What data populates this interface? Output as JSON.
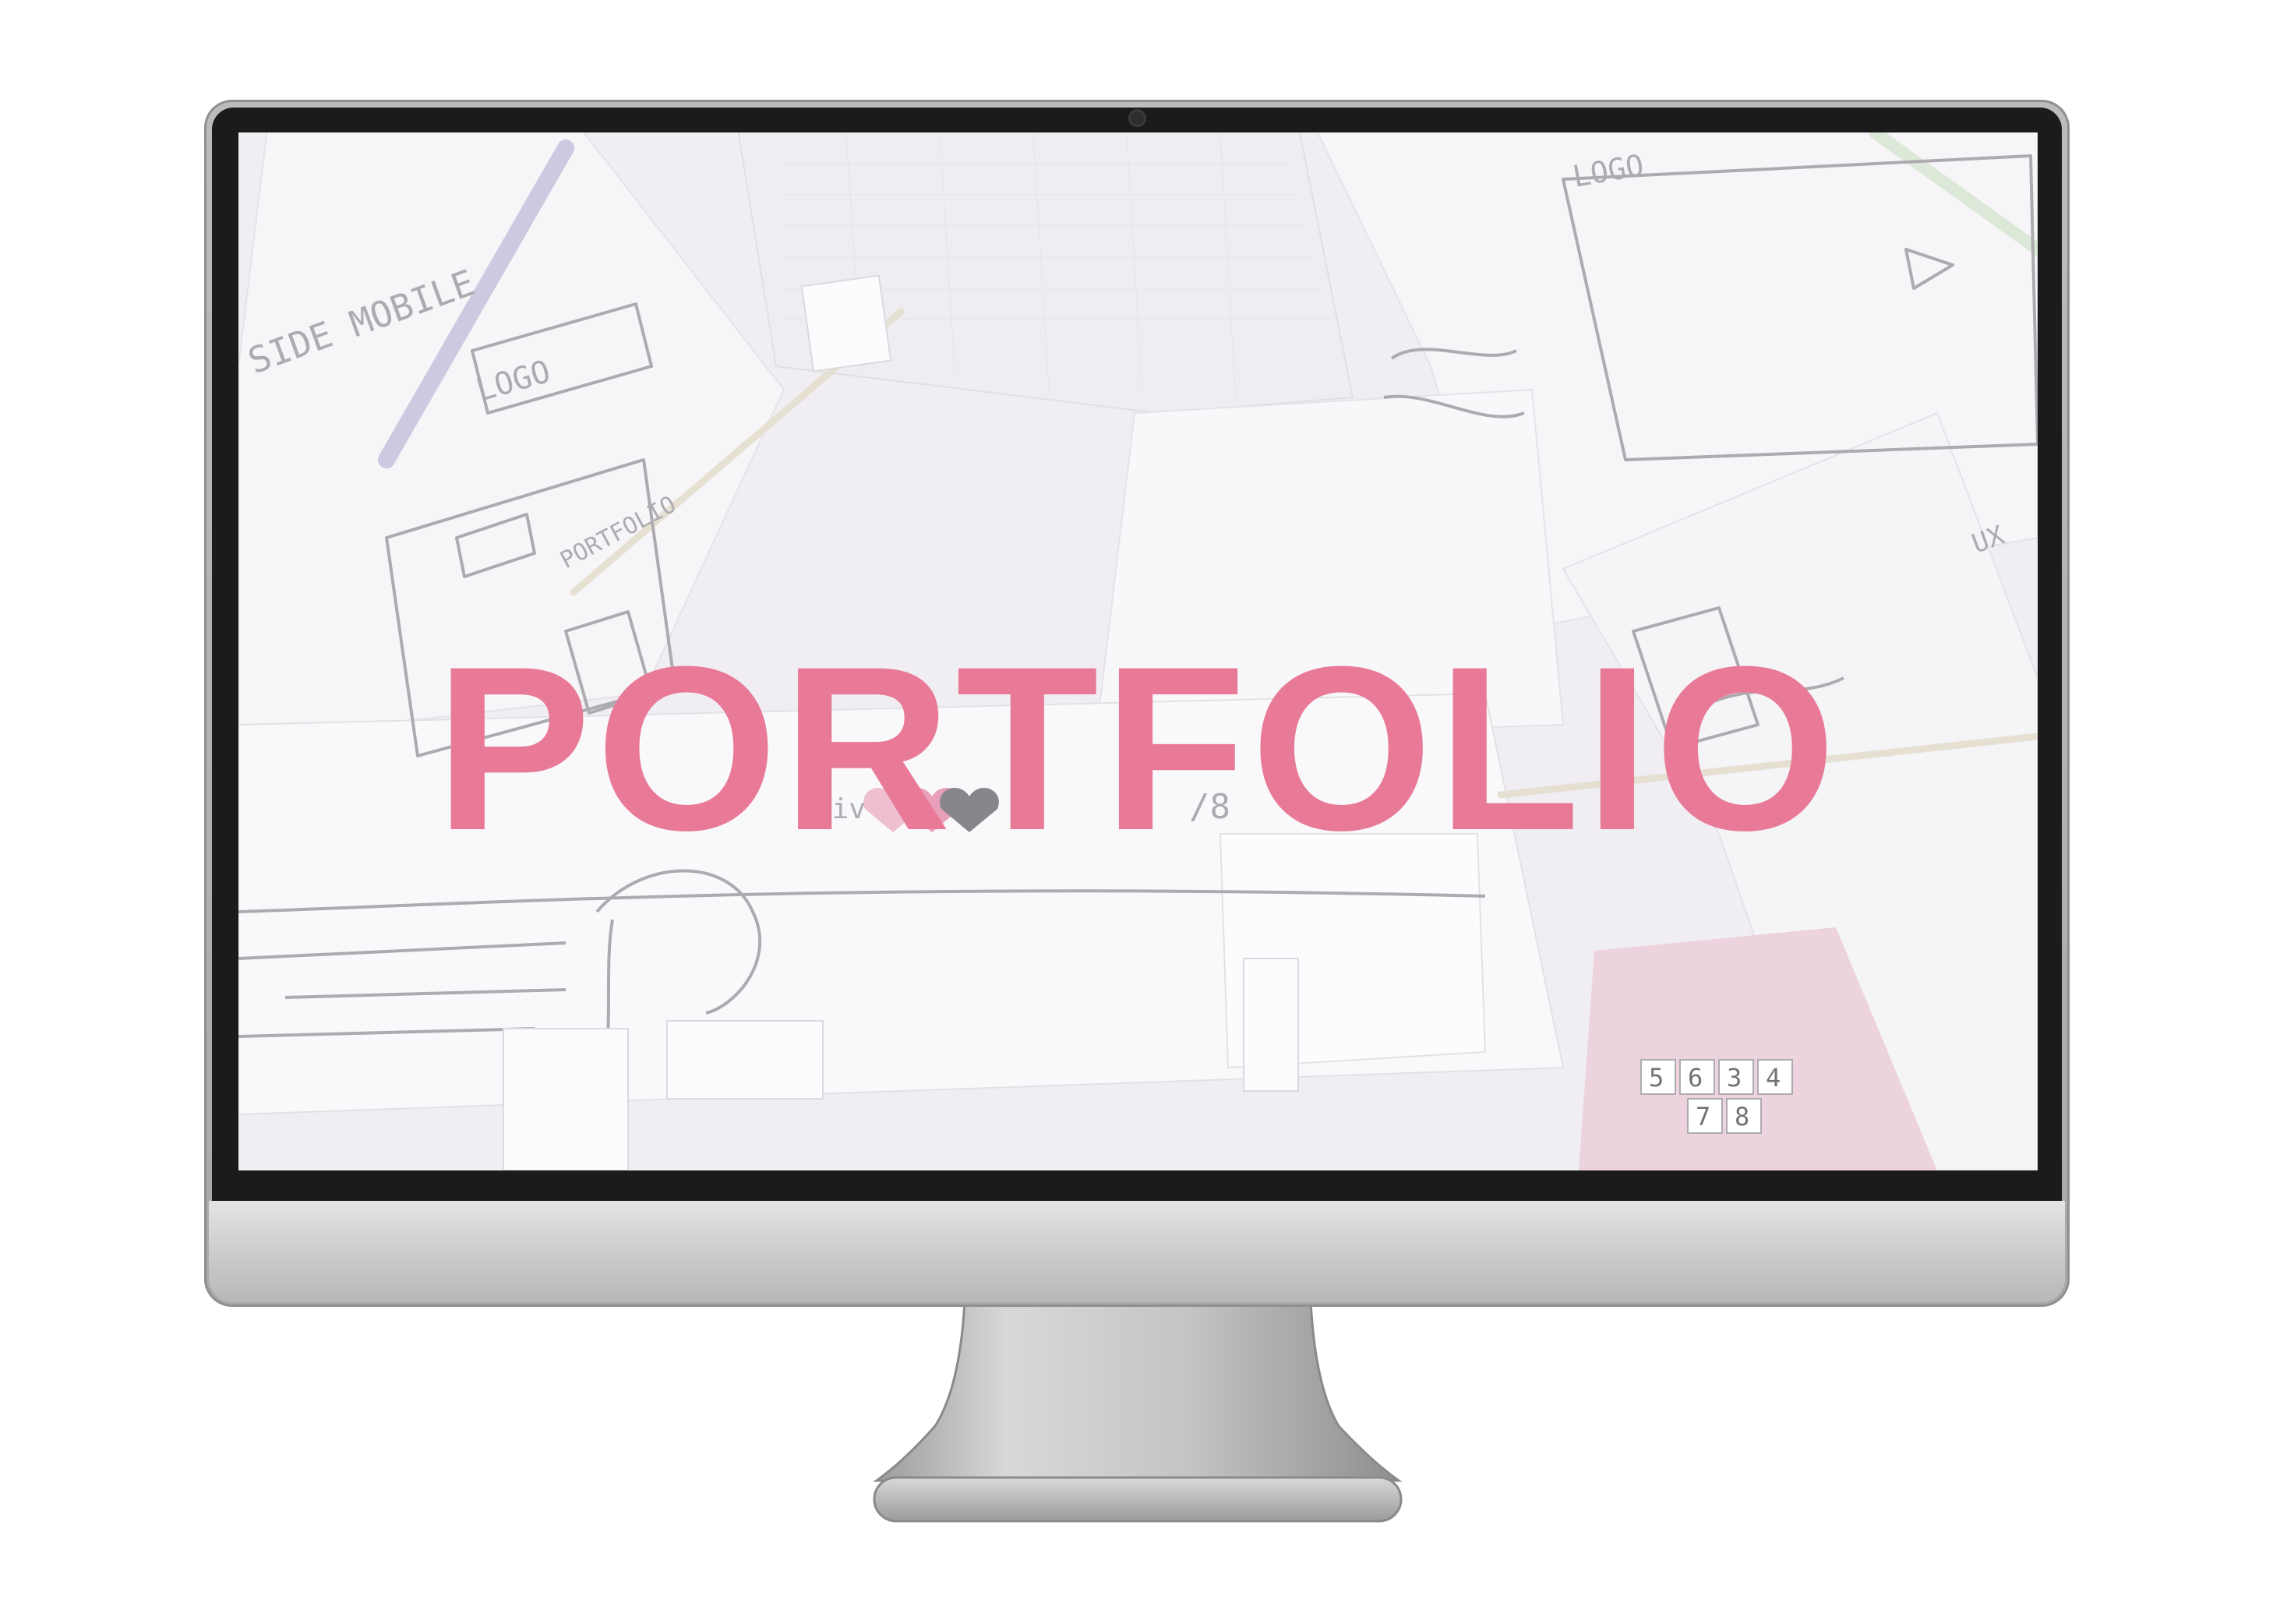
{
  "screen": {
    "hero_title": "PORTFOLIO",
    "title_color": "#e97a97",
    "background_photo": {
      "tint": "#ebe8ef",
      "sketch_labels": {
        "mobile_label": "SIDE MOBILE",
        "logo_label": "LOGO",
        "logo_label_right": "LOGO",
        "portfolio_label": "PORTFOLIO",
        "counter_label": "/8",
        "liv_label": "liv",
        "ux_label": "UX",
        "card_numbers": [
          "3",
          "4",
          "5",
          "6",
          "7",
          "8"
        ]
      }
    }
  },
  "device": {
    "frame_color": "#b3b3b3",
    "bezel_color": "#1b1b1b"
  }
}
